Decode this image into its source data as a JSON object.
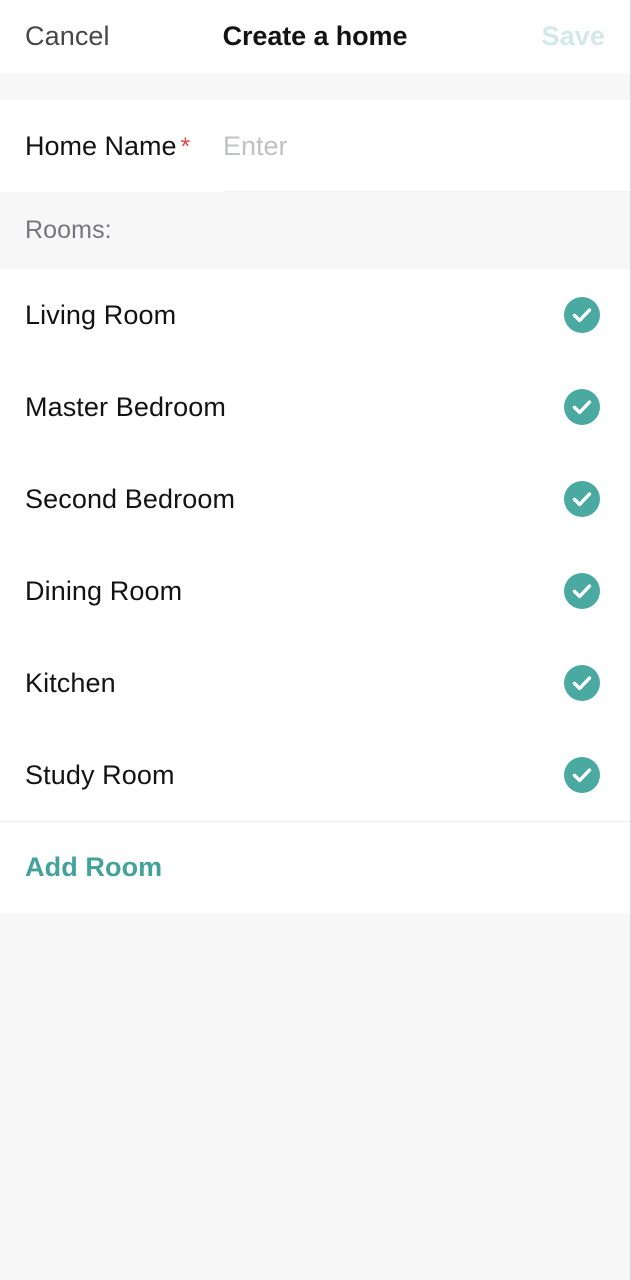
{
  "header": {
    "cancel_label": "Cancel",
    "title": "Create a home",
    "save_label": "Save"
  },
  "form": {
    "home_name": {
      "label": "Home Name",
      "required_marker": "*",
      "placeholder": "Enter",
      "value": ""
    }
  },
  "rooms_section": {
    "label": "Rooms:",
    "items": [
      {
        "name": "Living Room",
        "selected": true,
        "icon": "check-circle-icon"
      },
      {
        "name": "Master Bedroom",
        "selected": true,
        "icon": "check-circle-icon"
      },
      {
        "name": "Second Bedroom",
        "selected": true,
        "icon": "check-circle-icon"
      },
      {
        "name": "Dining Room",
        "selected": true,
        "icon": "check-circle-icon"
      },
      {
        "name": "Kitchen",
        "selected": true,
        "icon": "check-circle-icon"
      },
      {
        "name": "Study Room",
        "selected": true,
        "icon": "check-circle-icon"
      }
    ],
    "add_room_label": "Add Room"
  },
  "colors": {
    "accent_teal": "#4aa9a0",
    "add_room_teal": "#43a39a",
    "save_disabled": "#d3e9e6",
    "required_red": "#e2474b",
    "text_primary": "#131314",
    "text_secondary": "#76777a",
    "placeholder": "#c0c1c3",
    "page_background": "#f7f7f8",
    "card_background": "#ffffff"
  }
}
